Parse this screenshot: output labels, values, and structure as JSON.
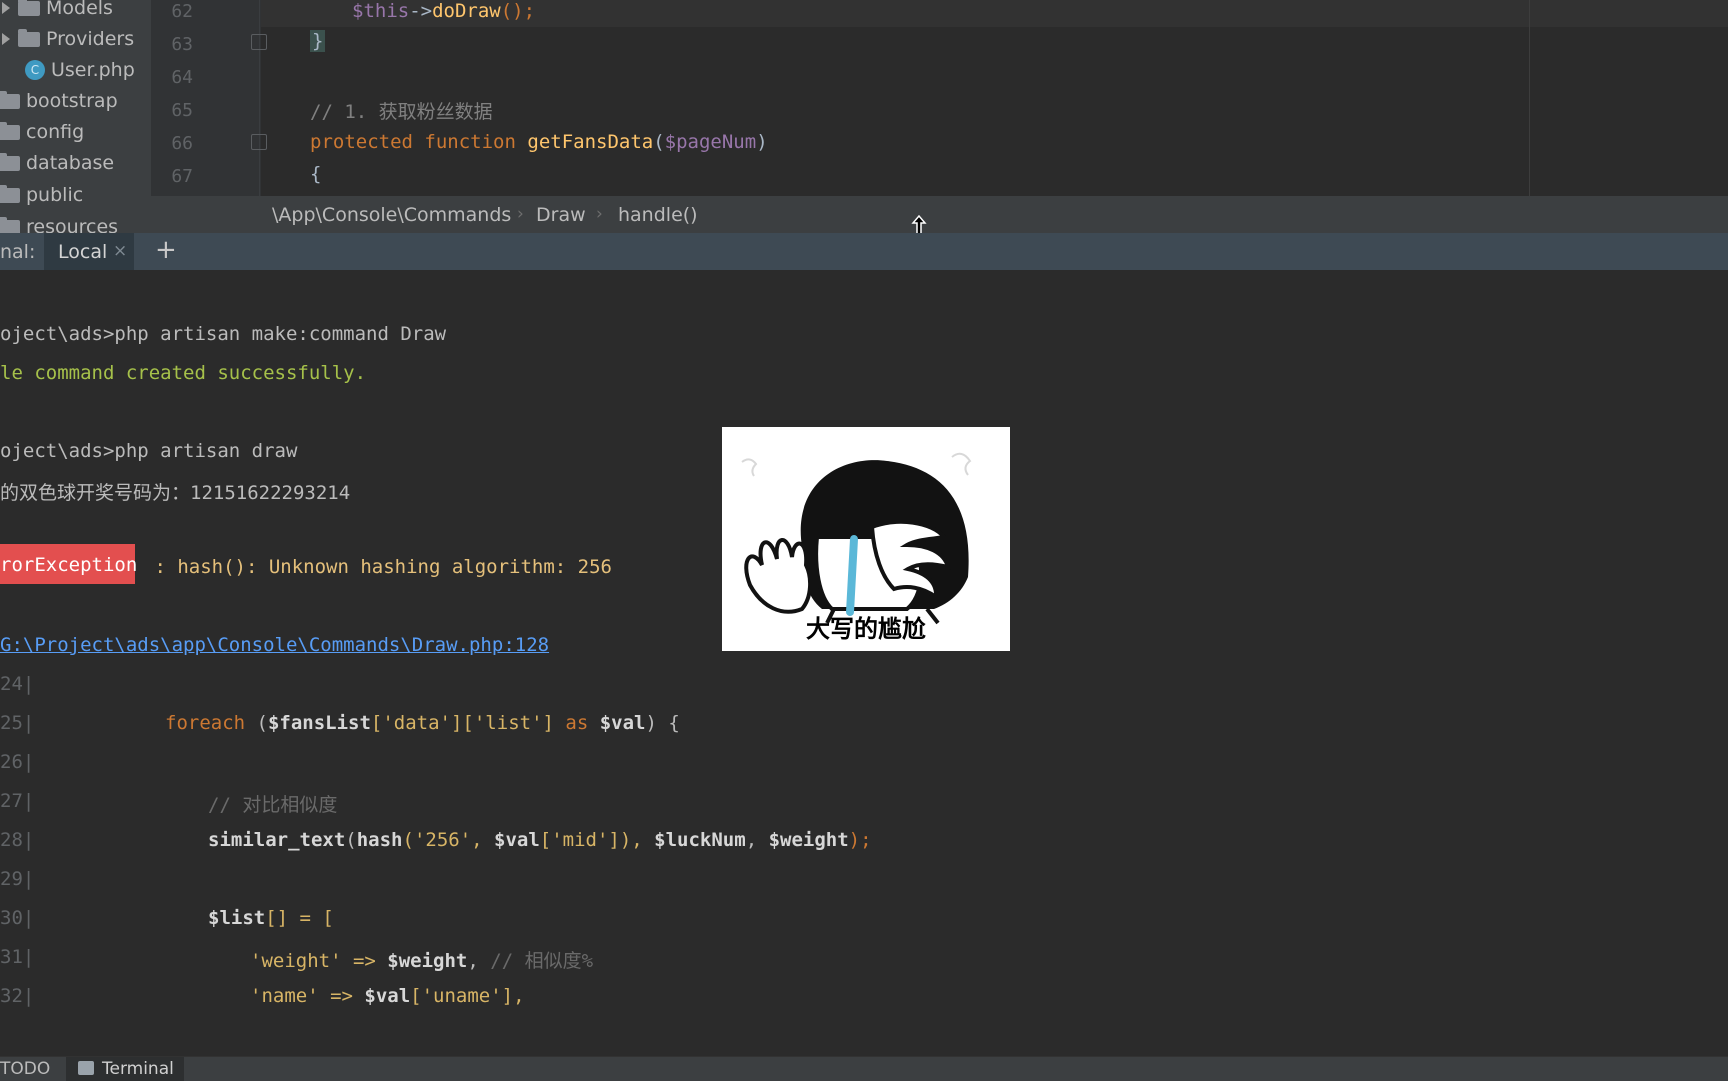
{
  "project_tree": {
    "items": [
      {
        "label": "Models",
        "type": "folder",
        "expandable": true
      },
      {
        "label": "Providers",
        "type": "folder",
        "expandable": true
      },
      {
        "label": "User.php",
        "type": "php-class"
      },
      {
        "label": "bootstrap",
        "type": "folder"
      },
      {
        "label": "config",
        "type": "folder"
      },
      {
        "label": "database",
        "type": "folder"
      },
      {
        "label": "public",
        "type": "folder"
      },
      {
        "label": "resources",
        "type": "folder"
      }
    ]
  },
  "editor": {
    "line_numbers": [
      "62",
      "63",
      "64",
      "65",
      "66",
      "67"
    ],
    "lines": {
      "l62": {
        "var": "$this",
        "arrow": "->",
        "method": "doDraw",
        "rest": "();"
      },
      "l63": {
        "brace": "}"
      },
      "l65": {
        "comment": "// 1. 获取粉丝数据"
      },
      "l66": {
        "kw1": "protected",
        "kw2": "function",
        "fn": "getFansData",
        "open": "(",
        "param": "$pageNum",
        "close": ")"
      },
      "l67": {
        "brace": "{"
      }
    }
  },
  "breadcrumb": {
    "namespace": "\\App\\Console\\Commands",
    "class": "Draw",
    "method": "handle()"
  },
  "terminal_tabs": {
    "label": "nal:",
    "tab": "Local",
    "close": "×",
    "add": "+"
  },
  "terminal": {
    "cmd1": "oject\\ads>php artisan make:command Draw",
    "out1": "le command created successfully.",
    "cmd2": "oject\\ads>php artisan draw",
    "out2": "的双色球开奖号码为：12151622293214",
    "error_badge": "rorException",
    "error_msg": " : hash(): Unknown hashing algorithm: 256",
    "error_link": "G:\\Project\\ads\\app\\Console\\Commands\\Draw.php:128",
    "snippet": {
      "line_nums": [
        "24|",
        "25|",
        "26|",
        "27|",
        "28|",
        "29|",
        "30|",
        "31|",
        "32|"
      ],
      "l125": {
        "kw": "foreach",
        "a": " (",
        "var": "$fansList",
        "b": "['data']['list'] ",
        "as": "as",
        "var2": " $val",
        "c": ") {"
      },
      "l127": "// 对比相似度",
      "l128": {
        "fn": "similar_text",
        "a": "(",
        "fn2": "hash",
        "b": "('256', ",
        "v1": "$val",
        "c": "['mid']), ",
        "v2": "$luckNum",
        "d": ", ",
        "v3": "$weight",
        "e": ");"
      },
      "l130": {
        "var": "$list",
        "rest": "[] = ["
      },
      "l131": {
        "key": "'weight'",
        "arrow": " => ",
        "var": "$weight",
        "comma": ", ",
        "comment": "// 相似度%"
      },
      "l132": {
        "key": "'name'",
        "arrow": " => ",
        "var": "$val",
        "rest": "['uname'],"
      }
    }
  },
  "meme": {
    "caption": "大写的尴尬"
  },
  "bottom_tools": {
    "todo": "TODO",
    "terminal": "Terminal"
  }
}
